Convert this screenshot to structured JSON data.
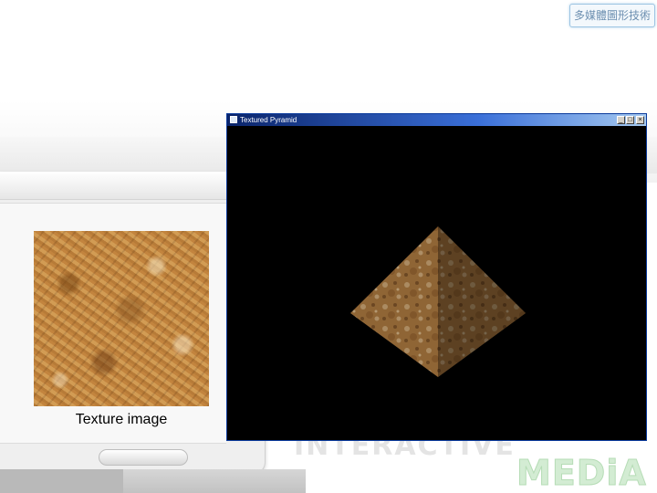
{
  "badge": {
    "text": "多媒體圖形技術"
  },
  "texture_panel": {
    "caption": "Texture image"
  },
  "window": {
    "title": "Textured Pyramid",
    "buttons": {
      "minimize": "_",
      "maximize": "□",
      "close": "×"
    }
  },
  "watermark": {
    "line1": "INTERACTIVE",
    "line2": "MEDiA"
  },
  "colors": {
    "titlebar_start": "#0a246a",
    "titlebar_end": "#a6caf0",
    "viewport": "#000000",
    "texture_base": "#c98d45"
  },
  "icons": [
    "window-app-icon",
    "minimize-icon",
    "maximize-icon",
    "close-icon"
  ]
}
